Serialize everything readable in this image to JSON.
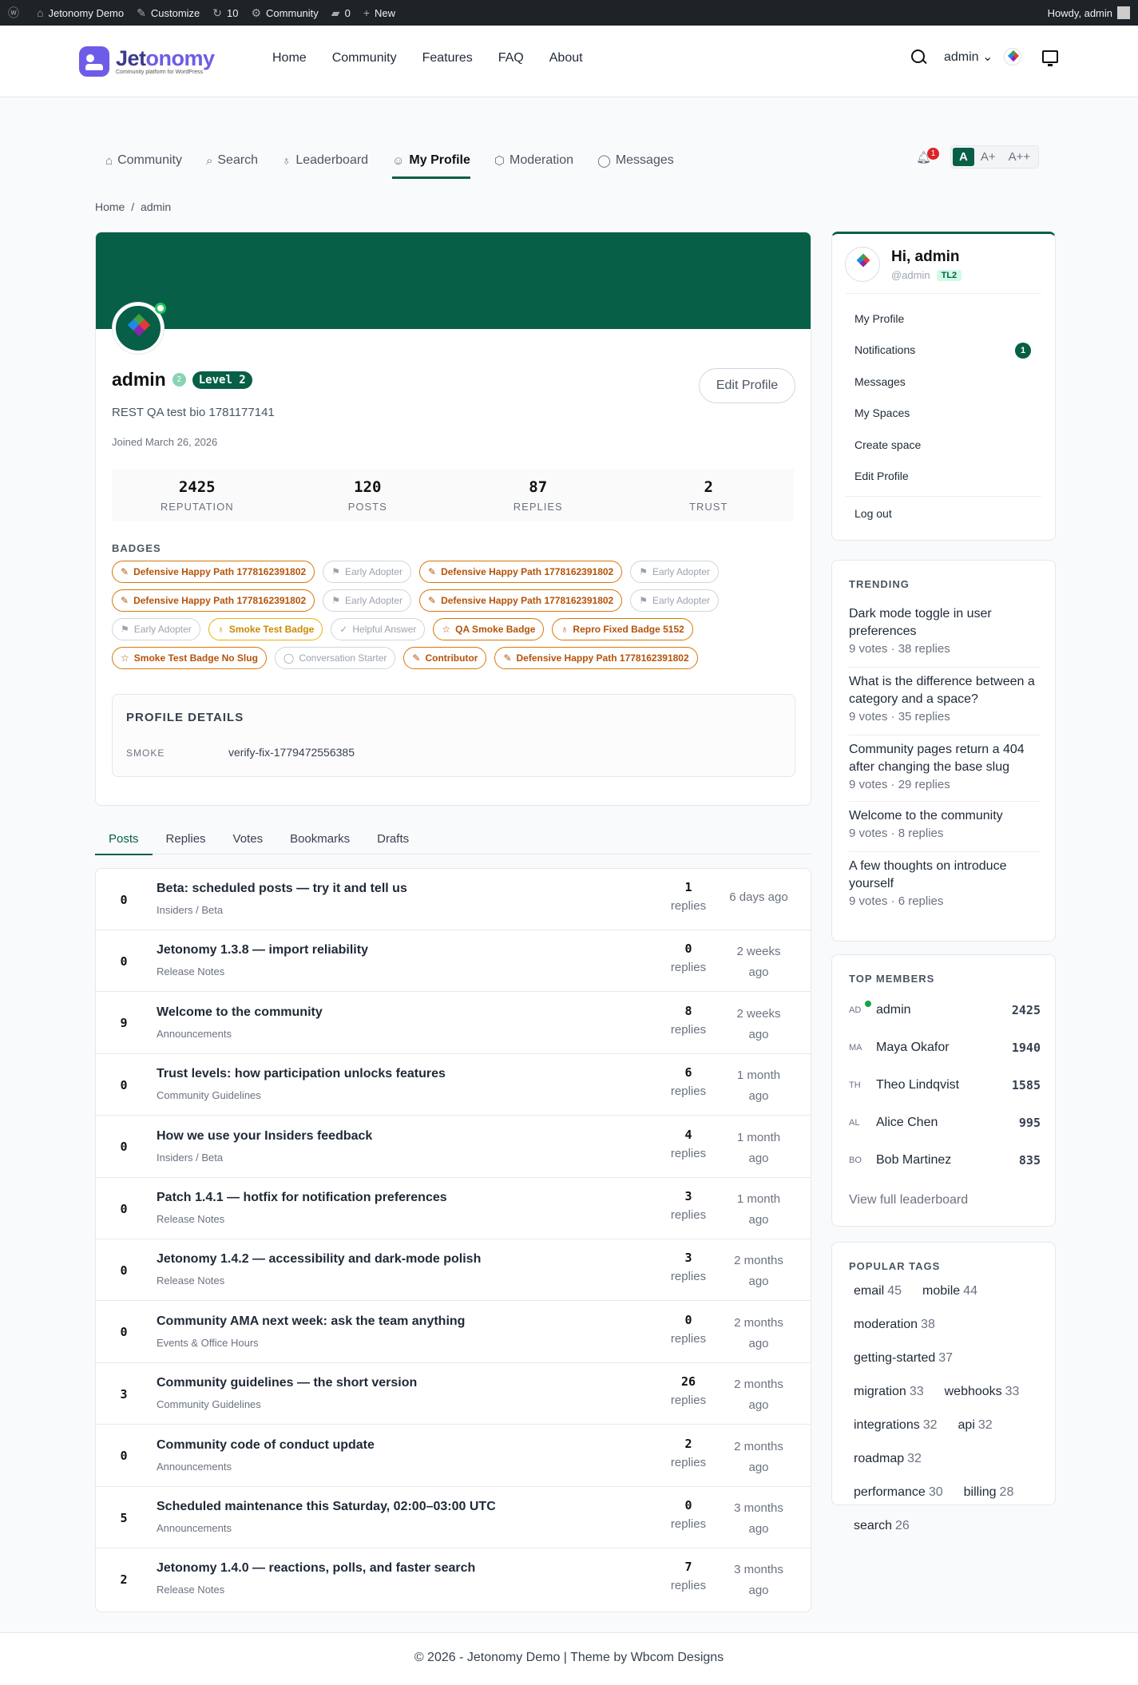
{
  "adminbar": {
    "site": "Jetonomy Demo",
    "customize": "Customize",
    "updates": "10",
    "community": "Community",
    "comments": "0",
    "new": "New",
    "howdy": "Howdy, admin"
  },
  "header": {
    "logo_name_a": "Jet",
    "logo_name_b": "onomy",
    "logo_sub": "Community platform for WordPress",
    "nav": [
      "Home",
      "Community",
      "Features",
      "FAQ",
      "About"
    ],
    "user": "admin"
  },
  "subnav": {
    "items": [
      "Community",
      "Search",
      "Leaderboard",
      "My Profile",
      "Moderation",
      "Messages"
    ],
    "notif_count": "1",
    "font_sizes": [
      "A",
      "A+",
      "A++"
    ]
  },
  "breadcrumb": {
    "home": "Home",
    "sep": "/",
    "current": "admin"
  },
  "profile": {
    "name": "admin",
    "trust_level": "2",
    "level": "Level 2",
    "edit_label": "Edit Profile",
    "bio": "REST QA test bio 1781177141",
    "joined": "Joined March 26, 2026",
    "stats": [
      {
        "value": "2425",
        "label": "REPUTATION"
      },
      {
        "value": "120",
        "label": "POSTS"
      },
      {
        "value": "87",
        "label": "REPLIES"
      },
      {
        "value": "2",
        "label": "TRUST"
      }
    ],
    "badges_label": "BADGES",
    "badges": [
      {
        "label": "Defensive Happy Path 1778162391802",
        "style": "o",
        "icon": "pencil-icon"
      },
      {
        "label": "Early Adopter",
        "style": "g",
        "icon": "flag-icon"
      },
      {
        "label": "Defensive Happy Path 1778162391802",
        "style": "o",
        "icon": "pencil-icon"
      },
      {
        "label": "Early Adopter",
        "style": "g",
        "icon": "flag-icon"
      },
      {
        "label": "Defensive Happy Path 1778162391802",
        "style": "o",
        "icon": "pencil-icon"
      },
      {
        "label": "Early Adopter",
        "style": "g",
        "icon": "flag-icon"
      },
      {
        "label": "Defensive Happy Path 1778162391802",
        "style": "o",
        "icon": "pencil-icon"
      },
      {
        "label": "Early Adopter",
        "style": "g",
        "icon": "flag-icon"
      },
      {
        "label": "Early Adopter",
        "style": "g",
        "icon": "flag-icon"
      },
      {
        "label": "Smoke Test Badge",
        "style": "y",
        "icon": "award-icon"
      },
      {
        "label": "Helpful Answer",
        "style": "g",
        "icon": "check-icon"
      },
      {
        "label": "QA Smoke Badge",
        "style": "o",
        "icon": "star-icon"
      },
      {
        "label": "Repro Fixed Badge 5152",
        "style": "o",
        "icon": "award-icon"
      },
      {
        "label": "Smoke Test Badge No Slug",
        "style": "o",
        "icon": "star-icon"
      },
      {
        "label": "Conversation Starter",
        "style": "g",
        "icon": "chat-icon"
      },
      {
        "label": "Contributor",
        "style": "o",
        "icon": "pencil-icon"
      },
      {
        "label": "Defensive Happy Path 1778162391802",
        "style": "o",
        "icon": "pencil-icon"
      }
    ],
    "details_title": "PROFILE DETAILS",
    "details_key": "SMOKE",
    "details_value": "verify-fix-1779472556385"
  },
  "tabs": [
    "Posts",
    "Replies",
    "Votes",
    "Bookmarks",
    "Drafts"
  ],
  "posts": [
    {
      "votes": "0",
      "title": "Beta: scheduled posts — try it and tell us",
      "cat": "Insiders / Beta",
      "replies": "1",
      "rlabel": "replies",
      "ago1": "6 days ago",
      "ago2": ""
    },
    {
      "votes": "0",
      "title": "Jetonomy 1.3.8 — import reliability",
      "cat": "Release Notes",
      "replies": "0",
      "rlabel": "replies",
      "ago1": "2 weeks",
      "ago2": "ago"
    },
    {
      "votes": "9",
      "title": "Welcome to the community",
      "cat": "Announcements",
      "replies": "8",
      "rlabel": "replies",
      "ago1": "2 weeks",
      "ago2": "ago"
    },
    {
      "votes": "0",
      "title": "Trust levels: how participation unlocks features",
      "cat": "Community Guidelines",
      "replies": "6",
      "rlabel": "replies",
      "ago1": "1 month",
      "ago2": "ago"
    },
    {
      "votes": "0",
      "title": "How we use your Insiders feedback",
      "cat": "Insiders / Beta",
      "replies": "4",
      "rlabel": "replies",
      "ago1": "1 month",
      "ago2": "ago"
    },
    {
      "votes": "0",
      "title": "Patch 1.4.1 — hotfix for notification preferences",
      "cat": "Release Notes",
      "replies": "3",
      "rlabel": "replies",
      "ago1": "1 month",
      "ago2": "ago"
    },
    {
      "votes": "0",
      "title": "Jetonomy 1.4.2 — accessibility and dark-mode polish",
      "cat": "Release Notes",
      "replies": "3",
      "rlabel": "replies",
      "ago1": "2 months",
      "ago2": "ago"
    },
    {
      "votes": "0",
      "title": "Community AMA next week: ask the team anything",
      "cat": "Events & Office Hours",
      "replies": "0",
      "rlabel": "replies",
      "ago1": "2 months",
      "ago2": "ago"
    },
    {
      "votes": "3",
      "title": "Community guidelines — the short version",
      "cat": "Community Guidelines",
      "replies": "26",
      "rlabel": "replies",
      "ago1": "2 months",
      "ago2": "ago"
    },
    {
      "votes": "0",
      "title": "Community code of conduct update",
      "cat": "Announcements",
      "replies": "2",
      "rlabel": "replies",
      "ago1": "2 months",
      "ago2": "ago"
    },
    {
      "votes": "5",
      "title": "Scheduled maintenance this Saturday, 02:00–03:00 UTC",
      "cat": "Announcements",
      "replies": "0",
      "rlabel": "replies",
      "ago1": "3 months",
      "ago2": "ago"
    },
    {
      "votes": "2",
      "title": "Jetonomy 1.4.0 — reactions, polls, and faster search",
      "cat": "Release Notes",
      "replies": "7",
      "rlabel": "replies",
      "ago1": "3 months",
      "ago2": "ago"
    }
  ],
  "sidebar": {
    "hi": "Hi, admin",
    "handle": "@admin",
    "tl": "TL2",
    "menu": [
      "My Profile",
      "Notifications",
      "Messages",
      "My Spaces",
      "Create space",
      "Edit Profile",
      "Log out"
    ],
    "notif_count": "1",
    "trending_title": "TRENDING",
    "trending": [
      {
        "title": "Dark mode toggle in user preferences",
        "meta": "9 votes · 38 replies"
      },
      {
        "title": "What is the difference between a category and a space?",
        "meta": "9 votes · 35 replies"
      },
      {
        "title": "Community pages return a 404 after changing the base slug",
        "meta": "9 votes · 29 replies"
      },
      {
        "title": "Welcome to the community",
        "meta": "9 votes · 8 replies"
      },
      {
        "title": "A few thoughts on introduce yourself",
        "meta": "9 votes · 6 replies"
      }
    ],
    "members_title": "TOP MEMBERS",
    "members": [
      {
        "ini": "AD",
        "name": "admin",
        "score": "2425"
      },
      {
        "ini": "MA",
        "name": "Maya Okafor",
        "score": "1940"
      },
      {
        "ini": "TH",
        "name": "Theo Lindqvist",
        "score": "1585"
      },
      {
        "ini": "AL",
        "name": "Alice Chen",
        "score": "995"
      },
      {
        "ini": "BO",
        "name": "Bob Martinez",
        "score": "835"
      }
    ],
    "view_all": "View full leaderboard",
    "tags_title": "POPULAR TAGS",
    "tags": [
      {
        "name": "email",
        "count": "45"
      },
      {
        "name": "mobile",
        "count": "44"
      },
      {
        "name": "moderation",
        "count": "38"
      },
      {
        "name": "getting-started",
        "count": "37"
      },
      {
        "name": "migration",
        "count": "33"
      },
      {
        "name": "webhooks",
        "count": "33"
      },
      {
        "name": "integrations",
        "count": "32"
      },
      {
        "name": "api",
        "count": "32"
      },
      {
        "name": "roadmap",
        "count": "32"
      },
      {
        "name": "performance",
        "count": "30"
      },
      {
        "name": "billing",
        "count": "28"
      },
      {
        "name": "search",
        "count": "26"
      }
    ]
  },
  "footer": {
    "text": "© 2026 - Jetonomy Demo | Theme by Wbcom Designs"
  }
}
